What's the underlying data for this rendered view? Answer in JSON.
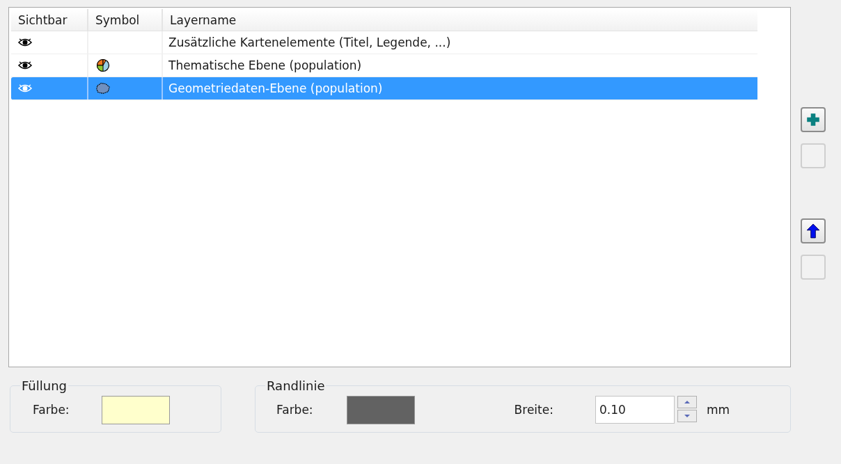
{
  "layer_table": {
    "columns": [
      "Sichtbar",
      "Symbol",
      "Layername"
    ],
    "rows": [
      {
        "visible": true,
        "kind": "none",
        "name": "Zusätzliche Kartenelemente (Titel, Legende, ...)",
        "selected": false
      },
      {
        "visible": true,
        "kind": "pie",
        "name": "Thematische Ebene (population)",
        "selected": false
      },
      {
        "visible": true,
        "kind": "polygon",
        "name": "Geometriedaten-Ebene (population)",
        "selected": true
      }
    ]
  },
  "side_buttons": [
    {
      "kind": "add",
      "disabled": false
    },
    {
      "kind": "remove",
      "disabled": true
    },
    {
      "kind": "up",
      "disabled": false
    },
    {
      "kind": "down",
      "disabled": true
    }
  ],
  "fill": {
    "title": "Füllung",
    "color_label": "Farbe:",
    "color": "#ffffcc"
  },
  "border": {
    "title": "Randlinie",
    "color_label": "Farbe:",
    "color": "#626262",
    "width_label": "Breite:",
    "width_value": "0.10",
    "unit": "mm"
  }
}
